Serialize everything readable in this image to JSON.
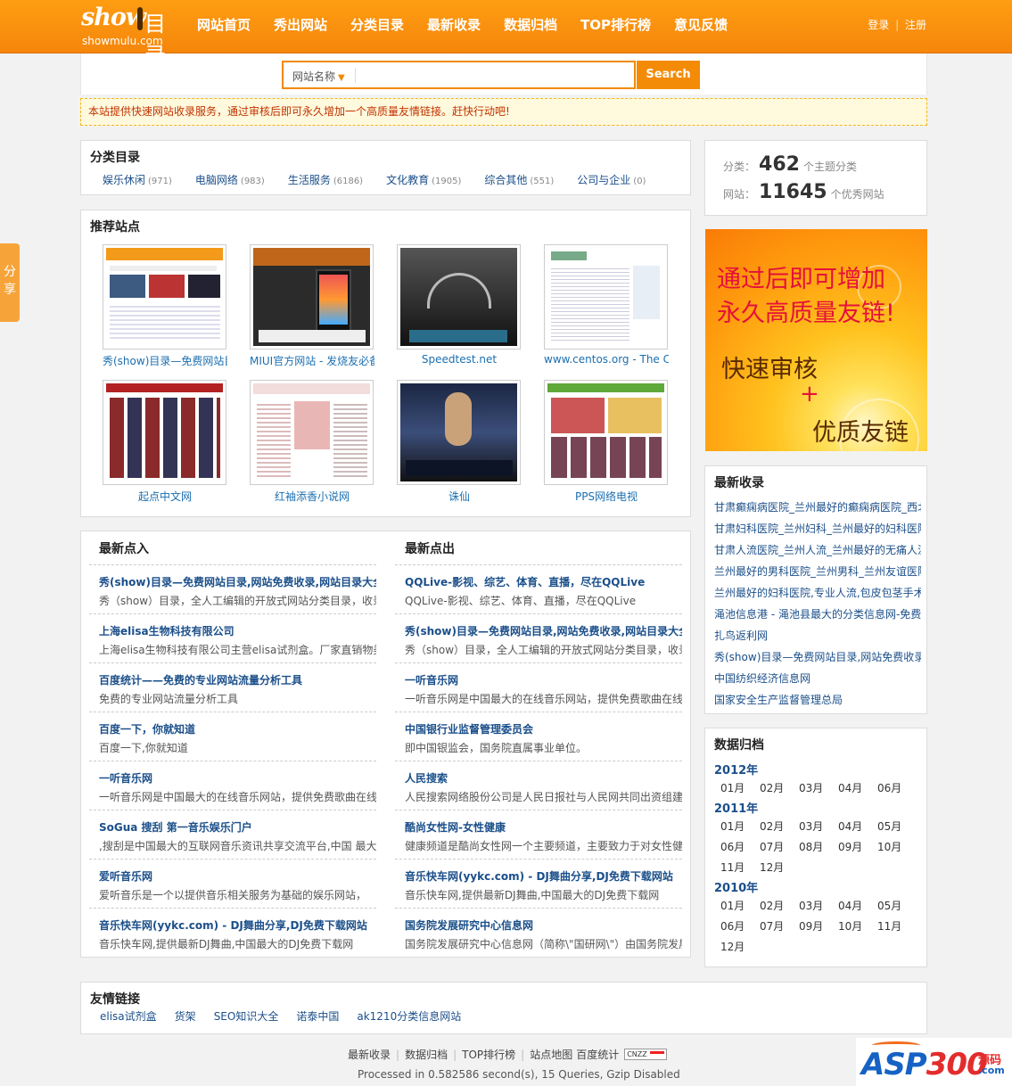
{
  "header": {
    "logo_show": "show",
    "logo_mulu": "目录",
    "logo_domain": "showmulu.com",
    "nav": [
      "网站首页",
      "秀出网站",
      "分类目录",
      "最新收录",
      "数据归档",
      "TOP排行榜",
      "意见反馈"
    ],
    "login": "登录",
    "register": "注册",
    "login_sep": "|"
  },
  "search": {
    "select_value": "网站名称",
    "input_value": "",
    "button": "Search"
  },
  "notice": "本站提供快速网站收录服务，通过审核后即可永久增加一个高质量友情链接。赶快行动吧!",
  "categories": {
    "title": "分类目录",
    "items": [
      {
        "name": "娱乐休闲",
        "count": "(971)"
      },
      {
        "name": "电脑网络",
        "count": "(983)"
      },
      {
        "name": "生活服务",
        "count": "(6186)"
      },
      {
        "name": "文化教育",
        "count": "(1905)"
      },
      {
        "name": "综合其他",
        "count": "(551)"
      },
      {
        "name": "公司与企业",
        "count": "(0)"
      }
    ]
  },
  "recommended": {
    "title": "推荐站点",
    "sites": [
      "秀(show)目录—免费网站目录",
      "MIUI官方网站 - 发烧友必备",
      "Speedtest.net",
      "www.centos.org - The Community ENTerprise",
      "起点中文网",
      "红袖添香小说网",
      "诛仙",
      "PPS网络电视"
    ]
  },
  "latest_in": {
    "title": "最新点入",
    "items": [
      {
        "title": "秀(show)目录—免费网站目录,网站免费收录,网站目录大全",
        "desc": "秀（show）目录，全人工编辑的开放式网站分类目录，收录优秀网站"
      },
      {
        "title": "上海elisa生物科技有限公司",
        "desc": "上海elisa生物科技有限公司主营elisa试剂盒。厂家直销物美价廉"
      },
      {
        "title": "百度统计——免费的专业网站流量分析工具",
        "desc": "免费的专业网站流量分析工具"
      },
      {
        "title": "百度一下，你就知道",
        "desc": "百度一下,你就知道"
      },
      {
        "title": "一听音乐网",
        "desc": "一听音乐网是中国最大的在线音乐网站，提供免费歌曲在线试听"
      },
      {
        "title": "SoGua 搜刮 第一音乐娱乐门户",
        "desc": ",搜刮是中国最大的互联网音乐资讯共享交流平台,中国 最大的"
      },
      {
        "title": "爱听音乐网",
        "desc": "爱听音乐是一个以提供音乐相关服务为基础的娱乐网站，"
      },
      {
        "title": "音乐快车网(yykc.com) - DJ舞曲分享,DJ免费下载网站",
        "desc": "音乐快车网,提供最新DJ舞曲,中国最大的DJ免费下载网"
      }
    ]
  },
  "latest_out": {
    "title": "最新点出",
    "items": [
      {
        "title": "QQLive-影视、综艺、体育、直播，尽在QQLive",
        "desc": "QQLive-影视、综艺、体育、直播，尽在QQLive"
      },
      {
        "title": "秀(show)目录—免费网站目录,网站免费收录,网站目录大全",
        "desc": "秀（show）目录，全人工编辑的开放式网站分类目录，收录优秀网站"
      },
      {
        "title": "一听音乐网",
        "desc": "一听音乐网是中国最大的在线音乐网站，提供免费歌曲在线试听"
      },
      {
        "title": "中国银行业监督管理委员会",
        "desc": "即中国银监会，国务院直属事业单位。"
      },
      {
        "title": "人民搜索",
        "desc": "人民搜索网络股份公司是人民日报社与人民网共同出资组建"
      },
      {
        "title": "酷尚女性网-女性健康",
        "desc": "健康频道是酷尚女性网一个主要频道，主要致力于对女性健康"
      },
      {
        "title": "音乐快车网(yykc.com) - DJ舞曲分享,DJ免费下载网站",
        "desc": "音乐快车网,提供最新DJ舞曲,中国最大的DJ免费下载网"
      },
      {
        "title": "国务院发展研究中心信息网",
        "desc": "国务院发展研究中心信息网（简称\\\"国研网\\\"）由国务院发展"
      }
    ]
  },
  "stats": {
    "cat_label": "分类：",
    "cat_count": "462",
    "cat_suffix": "个主题分类",
    "site_label": "网站：",
    "site_count": "11645",
    "site_suffix": "个优秀网站"
  },
  "ad": {
    "line1": "通过后即可增加",
    "line2": "永久高质量友链!",
    "line3": "快速审核",
    "plus": "+",
    "line4": "优质友链"
  },
  "newest": {
    "title": "最新收录",
    "items": [
      "甘肃癫痫病医院_兰州最好的癫痫病医院_西北癫痫病医院",
      "甘肃妇科医院_兰州妇科_兰州最好的妇科医院",
      "甘肃人流医院_兰州人流_兰州最好的无痛人流医院",
      "兰州最好的男科医院_兰州男科_兰州友谊医院",
      "兰州最好的妇科医院,专业人流,包皮包茎手术",
      "渑池信息港 - 渑池县最大的分类信息网-免费发布",
      "扎鸟返利网",
      "秀(show)目录—免费网站目录,网站免费收录,网站目录大全",
      "中国纺织经济信息网",
      "国家安全生产监督管理总局"
    ]
  },
  "archive": {
    "title": "数据归档",
    "years": [
      {
        "year": "2012年",
        "months": [
          "01月",
          "02月",
          "03月",
          "04月",
          "06月"
        ]
      },
      {
        "year": "2011年",
        "months": [
          "01月",
          "02月",
          "03月",
          "04月",
          "05月",
          "06月",
          "07月",
          "08月",
          "09月",
          "10月",
          "11月",
          "12月"
        ]
      },
      {
        "year": "2010年",
        "months": [
          "01月",
          "02月",
          "03月",
          "04月",
          "05月",
          "06月",
          "07月",
          "09月",
          "10月",
          "11月",
          "12月"
        ]
      }
    ]
  },
  "friend_links": {
    "title": "友情链接",
    "items": [
      "elisa试剂盒",
      "货架",
      "SEO知识大全",
      "诺泰中国",
      "ak1210分类信息网站"
    ]
  },
  "footer": {
    "links": [
      "最新收录",
      "数据归档",
      "TOP排行榜",
      "站点地图"
    ],
    "baidu": "百度统计",
    "cnzz": "CNZZ",
    "processed": "Processed in 0.582586 second(s), 15 Queries, Gzip Disabled"
  },
  "share": "分享",
  "watermark": {
    "brand_main": "ASP",
    "brand_num": "300",
    "brand_sub1": "源码",
    "brand_sub2": ".com"
  }
}
